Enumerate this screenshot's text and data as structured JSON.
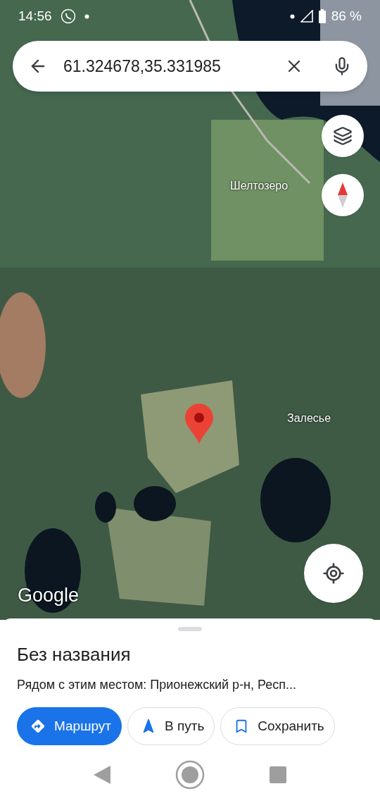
{
  "status_bar": {
    "time": "14:56",
    "battery": "86 %"
  },
  "search": {
    "value": "61.324678,35.331985"
  },
  "map": {
    "labels": [
      {
        "text": "Шелтозеро"
      },
      {
        "text": "Залесье"
      }
    ],
    "logo": "Google"
  },
  "place": {
    "title": "Без названия",
    "subtitle": "Рядом с этим местом: Прионежский р-н, Респ..."
  },
  "actions": [
    {
      "kind": "route",
      "label": "Маршрут",
      "primary": true
    },
    {
      "kind": "navigate",
      "label": "В путь",
      "primary": false
    },
    {
      "kind": "save",
      "label": "Сохранить",
      "primary": false
    }
  ]
}
